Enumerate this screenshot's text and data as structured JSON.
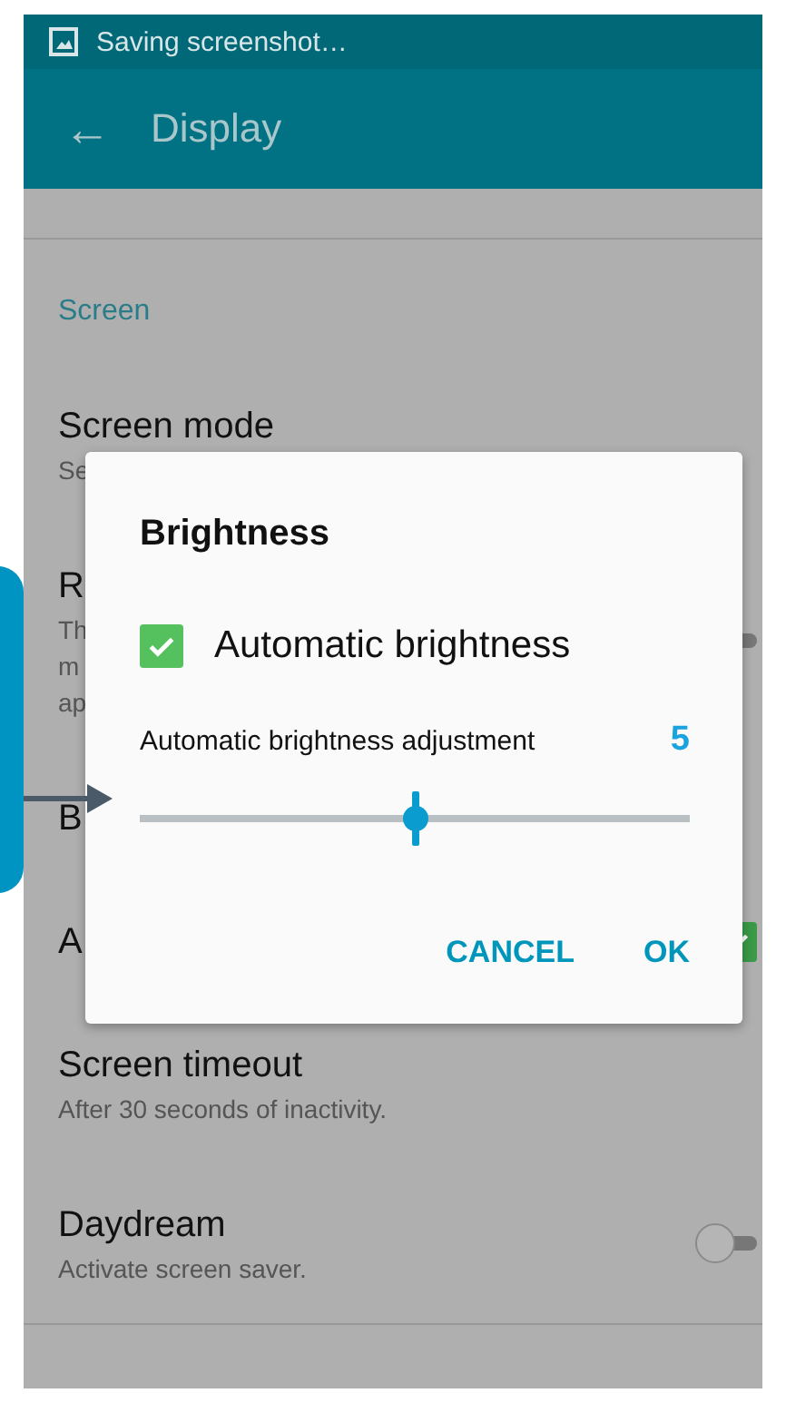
{
  "status_bar": {
    "text": "Saving screenshot…"
  },
  "app_bar": {
    "back": "←",
    "title": "Display"
  },
  "section": "Screen",
  "settings": [
    {
      "title": "Screen mode",
      "subtitle": [
        "Se"
      ],
      "kind": "plain"
    },
    {
      "title": "R",
      "subtitle": [
        "Th",
        "m",
        "ap"
      ],
      "kind": "toggle",
      "on": false
    },
    {
      "title": "B",
      "kind": "plain"
    },
    {
      "title": "A",
      "kind": "checkbox",
      "checked": true
    },
    {
      "title": "Screen timeout",
      "subtitle": [
        "After 30 seconds of inactivity."
      ],
      "kind": "plain"
    },
    {
      "title": "Daydream",
      "subtitle": [
        "Activate screen saver."
      ],
      "kind": "toggle",
      "on": false
    }
  ],
  "dialog": {
    "title": "Brightness",
    "checkbox": {
      "label": "Automatic brightness",
      "checked": true
    },
    "slider": {
      "label": "Automatic brightness adjustment",
      "reading": "5",
      "level": 0.5
    },
    "buttons": [
      "CANCEL",
      "OK"
    ]
  }
}
